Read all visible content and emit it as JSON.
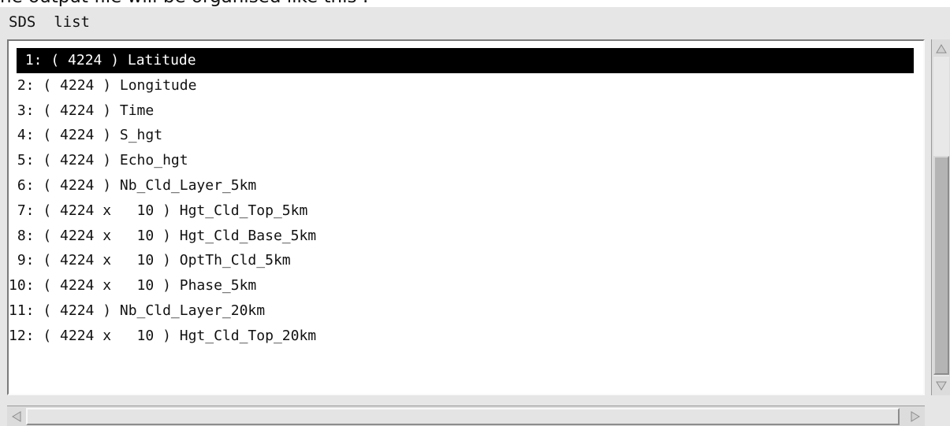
{
  "header_cut_text": "he output file will be organised like this :",
  "panel": {
    "title": "SDS  list"
  },
  "sds_list": {
    "selected_index": 0,
    "items": [
      {
        "label": " 1: ( 4224 ) Latitude"
      },
      {
        "label": " 2: ( 4224 ) Longitude"
      },
      {
        "label": " 3: ( 4224 ) Time"
      },
      {
        "label": " 4: ( 4224 ) S_hgt"
      },
      {
        "label": " 5: ( 4224 ) Echo_hgt"
      },
      {
        "label": " 6: ( 4224 ) Nb_Cld_Layer_5km"
      },
      {
        "label": " 7: ( 4224 x   10 ) Hgt_Cld_Top_5km"
      },
      {
        "label": " 8: ( 4224 x   10 ) Hgt_Cld_Base_5km"
      },
      {
        "label": " 9: ( 4224 x   10 ) OptTh_Cld_5km"
      },
      {
        "label": "10: ( 4224 x   10 ) Phase_5km"
      },
      {
        "label": "11: ( 4224 ) Nb_Cld_Layer_20km"
      },
      {
        "label": "12: ( 4224 x   10 ) Hgt_Cld_Top_20km"
      }
    ]
  },
  "icons": {
    "scroll_up": "triangle-up-icon",
    "scroll_down": "triangle-down-icon",
    "scroll_left": "triangle-left-icon",
    "scroll_right": "triangle-right-icon"
  },
  "colors": {
    "selection_bg": "#000000",
    "selection_fg": "#ffffff",
    "panel_bg": "#e6e6e6",
    "list_bg": "#ffffff"
  }
}
